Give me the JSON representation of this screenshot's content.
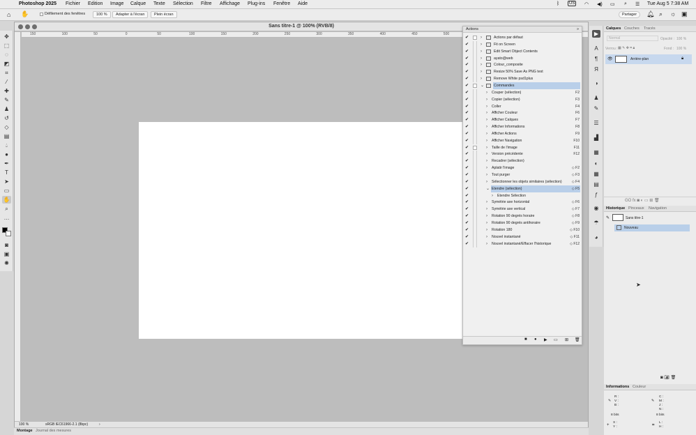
{
  "menubar": {
    "app": "Photoshop 2025",
    "items": [
      "Fichier",
      "Edition",
      "Image",
      "Calque",
      "Texte",
      "Sélection",
      "Filtre",
      "Affichage",
      "Plug-ins",
      "Fenêtre",
      "Aide"
    ],
    "status": {
      "input": "US",
      "datetime": "Tue Aug 5  7:38 AM"
    }
  },
  "options": {
    "scroll_all": "Défilement des fenêtres",
    "zoom": "100 %",
    "fit": "Adapter à l'écran",
    "full": "Plein écran",
    "share": "Partager"
  },
  "document": {
    "title": "Sans titre-1 @ 100% (RVB/8)",
    "zoom": "100 %",
    "profile": "sRGB IEC61966-2.1 (8bpc)",
    "ruler": [
      "150",
      "100",
      "50",
      "0",
      "50",
      "100",
      "150",
      "200",
      "250",
      "300",
      "350",
      "400",
      "450",
      "500",
      "550",
      "600",
      "650",
      "700"
    ]
  },
  "bottom_tabs": [
    "Montage",
    "Journal des mesures"
  ],
  "actions": {
    "title": "Actions",
    "rows": [
      {
        "label": "Actions par défaut",
        "level": 0,
        "folder": true,
        "expanded": false,
        "box": true
      },
      {
        "label": "Fit on Screen",
        "level": 0,
        "folder": true,
        "expanded": false
      },
      {
        "label": "Edit Smart Object Contents",
        "level": 0,
        "folder": true,
        "expanded": false
      },
      {
        "label": "ayato@web",
        "level": 0,
        "folder": true,
        "expanded": false
      },
      {
        "label": "Colour_composite",
        "level": 0,
        "folder": true,
        "expanded": false
      },
      {
        "label": "Resize 50% Save As PNG test",
        "level": 0,
        "folder": true,
        "expanded": false
      },
      {
        "label": "Remove White psd1plus",
        "level": 0,
        "folder": true,
        "expanded": false
      },
      {
        "label": "Commandes",
        "level": 0,
        "folder": true,
        "expanded": true,
        "selected": true,
        "box": true
      },
      {
        "label": "Couper (sélection)",
        "level": 1,
        "key": "F2"
      },
      {
        "label": "Copier (sélection)",
        "level": 1,
        "key": "F3"
      },
      {
        "label": "Coller",
        "level": 1,
        "key": "F4"
      },
      {
        "label": "Afficher Couleur",
        "level": 1,
        "key": "F6"
      },
      {
        "label": "Afficher Calques",
        "level": 1,
        "key": "F7"
      },
      {
        "label": "Afficher Informations",
        "level": 1,
        "key": "F8"
      },
      {
        "label": "Afficher Actions",
        "level": 1,
        "key": "F9"
      },
      {
        "label": "Afficher Navigation",
        "level": 1,
        "key": "F10"
      },
      {
        "label": "Taille de l'image",
        "level": 1,
        "key": "F11",
        "box": true
      },
      {
        "label": "Version précédente",
        "level": 1,
        "key": "F12"
      },
      {
        "label": "Recadrer (sélection)",
        "level": 1,
        "key": ""
      },
      {
        "label": "Aplatir l'image",
        "level": 1,
        "key": "◇ F2"
      },
      {
        "label": "Tout purger",
        "level": 1,
        "key": "◇ F3"
      },
      {
        "label": "Sélectionner les objets similaires (sélection)",
        "level": 1,
        "key": "◇ F4"
      },
      {
        "label": "Etendre (sélection)",
        "level": 1,
        "key": "◇ F5",
        "expanded": true,
        "selected": true
      },
      {
        "label": "Etendre Sélection",
        "level": 2,
        "key": ""
      },
      {
        "label": "Symétrie axe horizontal",
        "level": 1,
        "key": "◇ F6"
      },
      {
        "label": "Symétrie axe vertical",
        "level": 1,
        "key": "◇ F7"
      },
      {
        "label": "Rotation 90 degrés horaire",
        "level": 1,
        "key": "◇ F8"
      },
      {
        "label": "Rotation 90 degrés antihoraire",
        "level": 1,
        "key": "◇ F9"
      },
      {
        "label": "Rotation 180",
        "level": 1,
        "key": "◇ F10"
      },
      {
        "label": "Nouvel instantané",
        "level": 1,
        "key": "◇ F11"
      },
      {
        "label": "Nouvel instantané/Effacer l'historique",
        "level": 1,
        "key": "◇ F12"
      }
    ]
  },
  "layers": {
    "tabs": [
      "Calques",
      "Couches",
      "Tracés"
    ],
    "blend": "Normal",
    "opacity_label": "Opacité :",
    "opacity": "100 %",
    "lock_label": "Verrou :",
    "fill_label": "Fond :",
    "fill": "100 %",
    "layer_name": "Arrière-plan"
  },
  "history": {
    "tabs": [
      "Historique",
      "Pinceaux",
      "Navigation"
    ],
    "snapshot": "Sans titre-1",
    "items": [
      "Nouveau"
    ]
  },
  "info": {
    "tabs": [
      "Informations",
      "Couleur"
    ],
    "rgb": [
      "R :",
      "V :",
      "B :"
    ],
    "cmyk": [
      "C :",
      "M :",
      "J :",
      "N :"
    ],
    "bits1": "8 bits",
    "bits2": "8 bits",
    "xy": [
      "X :",
      "Y :"
    ],
    "wh": [
      "L :",
      "H :"
    ]
  }
}
